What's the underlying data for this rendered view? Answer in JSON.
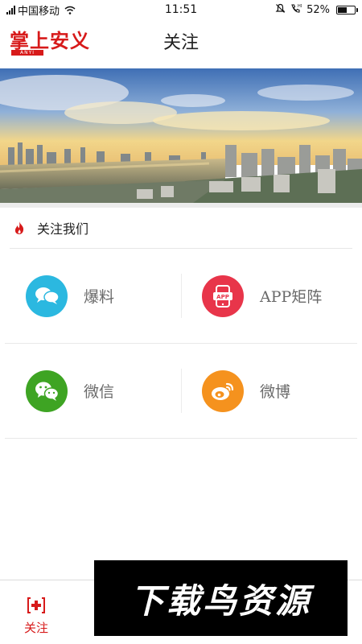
{
  "status_bar": {
    "carrier": "中国移动",
    "time": "11:51",
    "battery": "52%",
    "battery_level": 0.52
  },
  "header": {
    "logo_text": "掌上安义",
    "logo_sub": "ANYI",
    "title": "关注"
  },
  "section": {
    "title": "关注我们"
  },
  "grid": {
    "items": [
      {
        "label": "爆料",
        "icon": "chat-bubbles-icon",
        "color": "#2bb8e0"
      },
      {
        "label": "APP矩阵",
        "icon": "app-phone-icon",
        "color": "#e8354a"
      },
      {
        "label": "微信",
        "icon": "wechat-icon",
        "color": "#3ea423"
      },
      {
        "label": "微博",
        "icon": "weibo-icon",
        "color": "#f5921e"
      }
    ]
  },
  "tabbar": {
    "follow_label": "关注"
  },
  "watermark": {
    "text": "下载鸟资源"
  },
  "colors": {
    "brand_red": "#d71a1a"
  }
}
